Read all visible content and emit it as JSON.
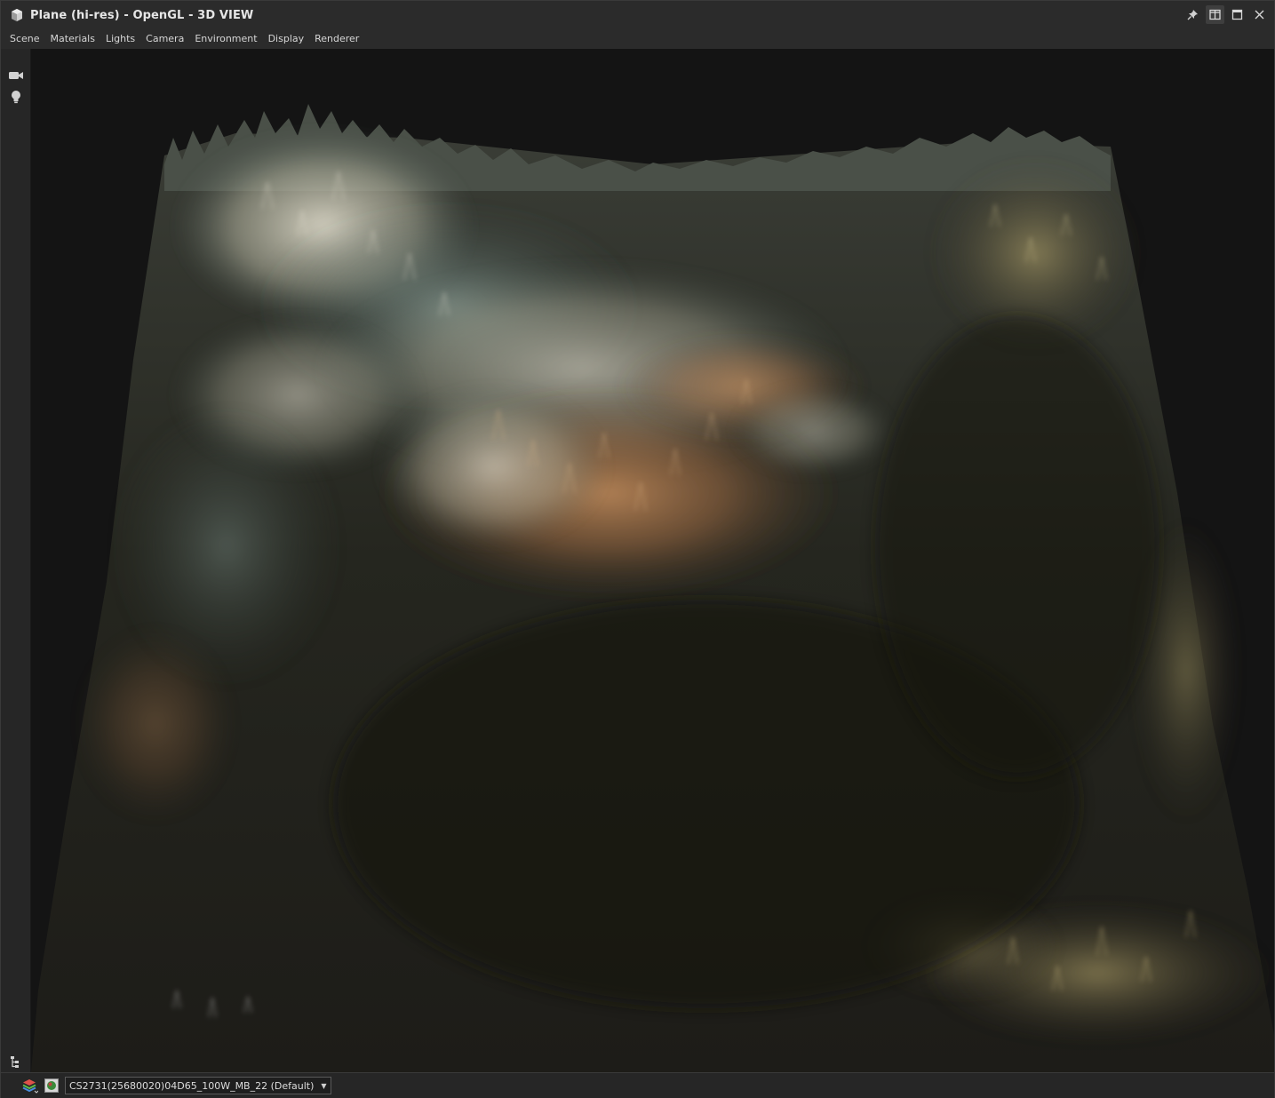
{
  "window": {
    "title": "Plane (hi-res) - OpenGL - 3D VIEW",
    "icon": "cube-icon"
  },
  "title_controls": [
    {
      "name": "pin-icon"
    },
    {
      "name": "split-view-icon"
    },
    {
      "name": "maximize-icon"
    },
    {
      "name": "close-icon"
    }
  ],
  "menu": {
    "items": [
      "Scene",
      "Materials",
      "Lights",
      "Camera",
      "Environment",
      "Display",
      "Renderer"
    ]
  },
  "left_toolbar": {
    "icons": [
      "camera-icon",
      "light-bulb-icon",
      "scene-tree-icon"
    ]
  },
  "statusbar": {
    "material_selector": {
      "selected": "CS2731(25680020)04D65_100W_MB_22 (Default)"
    }
  },
  "colors": {
    "titlebar": "#2b2b2b",
    "viewport": "#141414",
    "terrain_light": "#d8d4c4",
    "terrain_warm": "#b07a4e",
    "terrain_teal": "#6f8a86",
    "terrain_olive": "#a69a66"
  }
}
